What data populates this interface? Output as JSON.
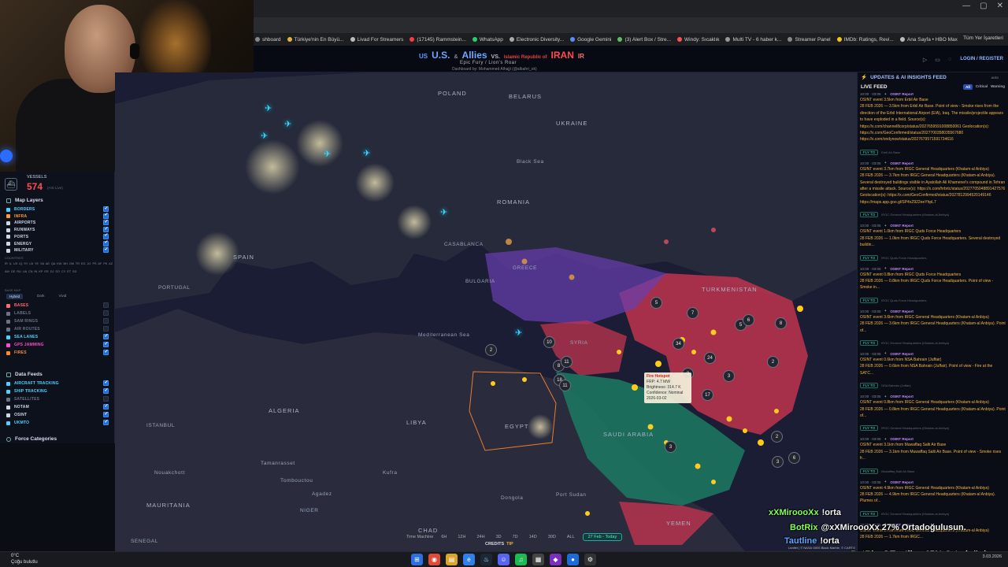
{
  "browser": {
    "bookmarks": [
      {
        "label": "shboard",
        "color": "#888"
      },
      {
        "label": "Türkiye'nin En Büyü...",
        "color": "#e8b23a"
      },
      {
        "label": "Livad For Streamers",
        "color": "#bbb"
      },
      {
        "label": "(17145) Rammstein...",
        "color": "#ff3b3b"
      },
      {
        "label": "WhatsApp",
        "color": "#25d366"
      },
      {
        "label": "Electronic Diversity...",
        "color": "#aaa"
      },
      {
        "label": "Google Gemini",
        "color": "#5b8cff"
      },
      {
        "label": "(3) Alert Box / Stre...",
        "color": "#60c060"
      },
      {
        "label": "Windy: Sıcaklık",
        "color": "#ff5050"
      },
      {
        "label": "Multi TV - 6 haber k...",
        "color": "#999"
      },
      {
        "label": "Streamer Panel",
        "color": "#888"
      },
      {
        "label": "IMDb: Ratings, Revi...",
        "color": "#f5c518"
      },
      {
        "label": "Ana Sayfa • HBO Max",
        "color": "#bbb"
      }
    ],
    "bookmarks_right": "Tüm Yer İşaretleri"
  },
  "header": {
    "us": "US",
    "us_name": "U.S.",
    "amp": "&",
    "allies": "Allies",
    "vs": "VS.",
    "irp": "Islamic Republic of",
    "iran": "IRAN",
    "ir": "IR",
    "subtitle": "Epic Fury / Lion's Roar",
    "credit": "Dashboard by: Mohammed Alhajji (@albahri_ok)",
    "login": "LOGIN / REGISTER"
  },
  "left_panel": {
    "vessels_label": "VESSELS",
    "vessels_count": "574",
    "vessels_sub": "(AIS Live)",
    "map_layers_title": "Map Layers",
    "layers": [
      {
        "label": "BORDERS",
        "color": "#4fd0ff",
        "checked": true
      },
      {
        "label": "INFRA",
        "color": "#ff9a3b",
        "checked": true
      },
      {
        "label": "AIRPORTS",
        "color": "#cfd6e6",
        "checked": true
      },
      {
        "label": "RUNWAYS",
        "color": "#cfd6e6",
        "checked": true
      },
      {
        "label": "PORTS",
        "color": "#cfd6e6",
        "checked": true
      },
      {
        "label": "ENERGY",
        "color": "#cfd6e6",
        "checked": true
      },
      {
        "label": "MILITARY",
        "color": "#cfd6e6",
        "checked": true
      }
    ],
    "countries_label": "COUNTRIES",
    "countries_codes": "IR IL US IQ SY LB YE SA AE QA KW BH OM TR EG JO PS AF PK AZ AM GE RU UA CN IN KP ER DJ SO CY ET SD",
    "basemap_label": "BASE MAP",
    "basemap_options": [
      "Hybrid",
      "Dark",
      "Vivid"
    ],
    "overlays": [
      {
        "label": "BASES",
        "color": "#ff6a6a",
        "checked": false
      },
      {
        "label": "LABELS",
        "color": "#6a7285",
        "checked": false
      },
      {
        "label": "SAM RINGS",
        "color": "#6a7285",
        "checked": false
      },
      {
        "label": "AIR ROUTES",
        "color": "#6a7285",
        "checked": false
      },
      {
        "label": "SEA LANES",
        "color": "#4fd0ff",
        "checked": true
      },
      {
        "label": "GPS JAMMING",
        "color": "#ff4bd0",
        "checked": true
      },
      {
        "label": "FIRES",
        "color": "#ff8a2b",
        "checked": true
      }
    ],
    "data_feeds_title": "Data Feeds",
    "feeds": [
      {
        "label": "AIRCRAFT TRACKING",
        "color": "#4fd0ff",
        "checked": true
      },
      {
        "label": "SHIP TRACKING",
        "color": "#4fd0ff",
        "checked": true
      },
      {
        "label": "SATELLITES",
        "color": "#6a7285",
        "checked": false
      },
      {
        "label": "NOTAM",
        "color": "#cfd6e6",
        "checked": true
      },
      {
        "label": "OSINT",
        "color": "#cfd6e6",
        "checked": true
      },
      {
        "label": "UKMTO",
        "color": "#4fd0ff",
        "checked": true
      }
    ],
    "force_categories": "Force Categories"
  },
  "map": {
    "labels": [
      {
        "text": "BELARUS",
        "kind": "big"
      },
      {
        "text": "POLAND",
        "kind": "big"
      },
      {
        "text": "UKRAINE",
        "kind": "big"
      },
      {
        "text": "ROMANIA",
        "kind": "big"
      },
      {
        "text": "SPAIN",
        "kind": "big"
      },
      {
        "text": "PORTUGAL",
        "kind": ""
      },
      {
        "text": "ALGERIA",
        "kind": "big"
      },
      {
        "text": "LIBYA",
        "kind": "big"
      },
      {
        "text": "EGYPT",
        "kind": "big"
      },
      {
        "text": "MAURITANIA",
        "kind": "big"
      },
      {
        "text": "CHAD",
        "kind": "big"
      },
      {
        "text": "SENEGAL",
        "kind": ""
      },
      {
        "text": "NIGER",
        "kind": ""
      },
      {
        "text": "TURKMENISTAN",
        "kind": "big"
      },
      {
        "text": "SAUDI ARABIA",
        "kind": "big"
      },
      {
        "text": "YEMEN",
        "kind": "big"
      },
      {
        "text": "SYRIA",
        "kind": ""
      },
      {
        "text": "Mediterranean Sea",
        "kind": ""
      },
      {
        "text": "Black Sea",
        "kind": ""
      },
      {
        "text": "CASABLANCA",
        "kind": ""
      },
      {
        "text": "BULGARIA",
        "kind": ""
      },
      {
        "text": "GREECE",
        "kind": ""
      },
      {
        "text": "ISTANBUL",
        "kind": ""
      },
      {
        "text": "Tamanrasset",
        "kind": ""
      },
      {
        "text": "Dongola",
        "kind": ""
      },
      {
        "text": "Port Sudan",
        "kind": ""
      },
      {
        "text": "Tombouctou",
        "kind": ""
      },
      {
        "text": "Nouakchott",
        "kind": ""
      },
      {
        "text": "Agadez",
        "kind": ""
      },
      {
        "text": "Kufra",
        "kind": ""
      }
    ],
    "clusters": [
      "10",
      "8",
      "11",
      "18",
      "5",
      "34",
      "24",
      "3",
      "5",
      "7",
      "17",
      "3",
      "2",
      "3",
      "6",
      "6",
      "2",
      "2",
      "3",
      "11",
      "8"
    ],
    "tooltip": {
      "title": "Fire Hotspot",
      "frp": "FRP: 4.7 MW",
      "brightness": "Brightness: 314.7 K",
      "confidence": "Confidence: Nominal",
      "date": "2026-03-02"
    },
    "timeline": {
      "label": "Time Machine",
      "options": [
        "6H",
        "12H",
        "24H",
        "3D",
        "7D",
        "14D",
        "30D",
        "ALL"
      ],
      "active": "27 Feb - Today"
    },
    "credits": "CREDITS",
    "tip": "TIP",
    "attribution": "Leaflet | © NASA GIBS Black Marble, © CARTO"
  },
  "feed": {
    "title": "UPDATES & AI INSIGHTS FEED",
    "title_sub": "auto",
    "live_label": "LIVE FEED",
    "tabs": [
      "All",
      "Critical",
      "Warning"
    ],
    "entries": [
      {
        "meta": "10:00 · 03:05",
        "src": "OSINT Report",
        "text": "OSINT event 3.5km from Erbil Air Base",
        "detail": "28 FEB 2026 — 3.5km from Erbil Air Base. Point of view - Smoke rises from the direction of the Erbil International Airport (EIA), Iraq. The missile/projectile appears to have exploded in a field. Source(s): https://x.com/channel8corp/status/2027659591008850061 Geolocation(s): https://x.com/GeoConfirmed/status/2027700358035567680 https://x.com/ondynow/status/2027679571591734616",
        "fly": "FLY TO",
        "ctx": "Erbil Air Base"
      },
      {
        "meta": "10:00 · 03:05",
        "src": "OSINT Report",
        "text": "OSINT event 3.7km from IRGC General Headquarters (Khatam-al Anbiya)",
        "detail": "28 FEB 2026 — 3.7km from IRGC General Headquarters (Khatam-al Anbiya). Several destroyed buildings visible in Ayatollah Ali Khamenei's compound in Tehran after a missile attack. Source(s): https://x.com/hrbrtc/status/2027705048891427576 Geolocation(s): https://x.com/GeoConfirmed/status/2027812994520149146 https://maps.app.goo.gl/SP4xZ922eeYhpL7",
        "fly": "FLY TO",
        "ctx": "IRGC General Headquarters (Khatam-al Anbiya)"
      },
      {
        "meta": "10:00 · 03:05",
        "src": "OSINT Report",
        "text": "OSINT event 1.0km from IRGC Quds Force Headquarters",
        "detail": "28 FEB 2026 — 1.0km from IRGC Quds Force Headquarters. Several destroyed buildin...",
        "fly": "FLY TO",
        "ctx": "IRGC Quds Force Headquarters"
      },
      {
        "meta": "10:00 · 03:05",
        "src": "OSINT Report",
        "text": "OSINT event 0.8km from IRGC Quds Force Headquarters",
        "detail": "28 FEB 2026 — 0.8km from IRGC Quds Force Headquarters. Point of view - Smoke in...",
        "fly": "FLY TO",
        "ctx": "IRGC Quds Force Headquarters"
      },
      {
        "meta": "10:00 · 03:05",
        "src": "OSINT Report",
        "text": "OSINT event 3.6km from IRGC General Headquarters (Khatam-al Anbiya)",
        "detail": "28 FEB 2026 — 3.6km from IRGC General Headquarters (Khatam-al Anbiya). Point of...",
        "fly": "FLY TO",
        "ctx": "IRGC General Headquarters (Khatam-al Anbiya)"
      },
      {
        "meta": "10:00 · 03:05",
        "src": "OSINT Report",
        "text": "OSINT event 0.6km from NSA Bahrain (Juffair)",
        "detail": "28 FEB 2026 — 0.6km from NSA Bahrain (Juffair). Point of view - Fire at the SATC...",
        "fly": "FLY TO",
        "ctx": "NSA Bahrain (Juffair)"
      },
      {
        "meta": "10:00 · 03:05",
        "src": "OSINT Report",
        "text": "OSINT event 0.8km from IRGC General Headquarters (Khatam-al Anbiya)",
        "detail": "28 FEB 2026 — 0.8km from IRGC General Headquarters (Khatam-al Anbiya). Point of...",
        "fly": "FLY TO",
        "ctx": "IRGC General Headquarters (Khatam-al Anbiya)"
      },
      {
        "meta": "10:00 · 03:05",
        "src": "OSINT Report",
        "text": "OSINT event 3.1km from Muwaffaq Salti Air Base",
        "detail": "28 FEB 2026 — 3.1km from Muwaffaq Salti Air Base. Point of view - Smoke rises fr...",
        "fly": "FLY TO",
        "ctx": "Muwaffaq Salti Air Base"
      },
      {
        "meta": "10:00 · 03:05",
        "src": "OSINT Report",
        "text": "OSINT event 4.9km from IRGC General Headquarters (Khatam-al Anbiya)",
        "detail": "28 FEB 2026 — 4.9km from IRGC General Headquarters (Khatam-al Anbiya). Plumes of...",
        "fly": "FLY TO",
        "ctx": "IRGC General Headquarters (Khatam-al Anbiya)"
      },
      {
        "meta": "10:00 · 03:05",
        "src": "OSINT Report",
        "text": "OSINT event 1.7km from IRGC General Headquarters (Khatam-al Anbiya)",
        "detail": "28 FEB 2026 — 1.7km from IRGC...",
        "fly": "",
        "ctx": ""
      }
    ]
  },
  "chat": [
    {
      "user": "xXMiroooXx",
      "color": "#7fff5a",
      "msg": "!orta"
    },
    {
      "user": "BotRix",
      "color": "#7fff5a",
      "msg": "@xXMiroooXx 27% Ortadoğulusun."
    },
    {
      "user": "Tautline",
      "color": "#5aa8ff",
      "msg": "!orta"
    },
    {
      "user": "BotRix",
      "color": "#7fff5a",
      "msg": "@Tautline 65% Ortadoğulusun."
    }
  ],
  "taskbar": {
    "temp": "0°C",
    "weather": "Çoğu bulutlu",
    "time": "3.03.2026"
  }
}
